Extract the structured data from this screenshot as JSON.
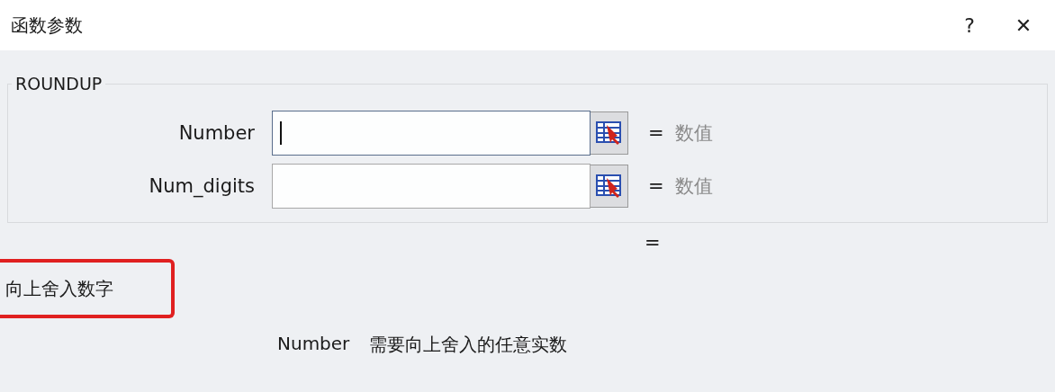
{
  "window": {
    "title": "函数参数",
    "help": "?",
    "close": "✕"
  },
  "function": {
    "name": "ROUNDUP",
    "params": [
      {
        "label": "Number",
        "focused": true,
        "equals": "=",
        "result": "数值"
      },
      {
        "label": "Num_digits",
        "focused": false,
        "equals": "=",
        "result": "数值"
      }
    ]
  },
  "formula_result": {
    "equals": "="
  },
  "summary": {
    "text": "向上舍入数字",
    "highlighted": true
  },
  "param_help": {
    "name": "Number",
    "text": "需要向上舍入的任意实数"
  }
}
